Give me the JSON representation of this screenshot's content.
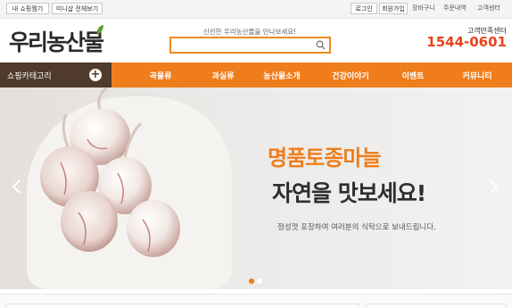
{
  "topbar": {
    "bookmark": "내 쇼핑찜기",
    "mini_site": "미니샵 전체보기",
    "login": "로그인",
    "join": "회원가입",
    "cart": "장바구니",
    "order": "주문내역",
    "service": "고객센터"
  },
  "header": {
    "logo": "우리농산물",
    "slogan": "신선한 우리농산물을 만나보세요!",
    "search_placeholder": "",
    "cs_label": "고객만족센터",
    "cs_phone": "1544-0601"
  },
  "nav": {
    "category": "쇼핑카테고리",
    "items": [
      "곡물류",
      "과실류",
      "농산물소개",
      "건강이야기",
      "이벤트",
      "커뮤니티"
    ]
  },
  "banner": {
    "headline1": "명품토종마늘",
    "headline2": "자연을 맛보세요!",
    "subline": "정성껏 포장하여 여러분의 식탁으로 보내드립니다.",
    "active_slide": 1,
    "slide_count": 2
  },
  "colors": {
    "accent": "#ef7d1b",
    "category_bg": "#4f3a2c",
    "phone": "#e8431a"
  }
}
